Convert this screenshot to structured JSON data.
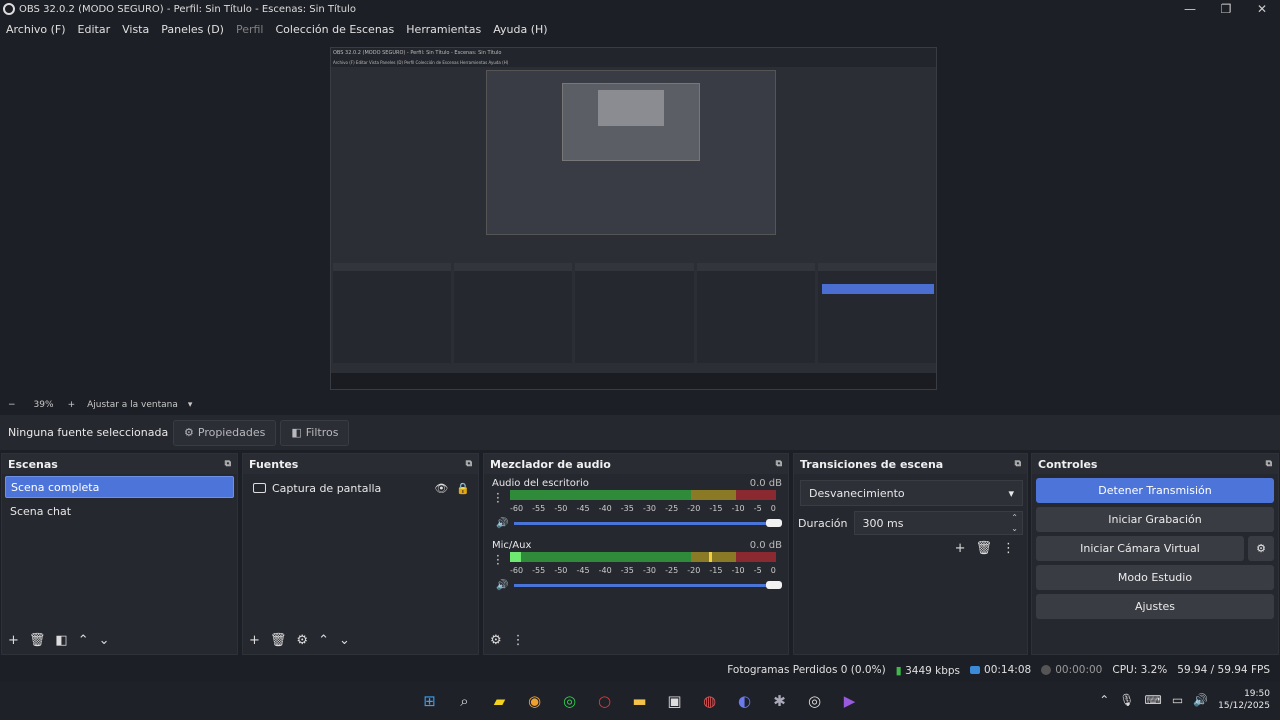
{
  "window": {
    "title": "OBS 32.0.2 (MODO SEGURO) - Perfil: Sin Título - Escenas: Sin Título",
    "minimize": "—",
    "maximize": "❐",
    "close": "✕"
  },
  "menu": [
    "Archivo (F)",
    "Editar",
    "Vista",
    "Paneles (D)",
    "Perfil",
    "Colección de Escenas",
    "Herramientas",
    "Ayuda (H)"
  ],
  "preview": {
    "inner_title": "OBS 32.0.2 (MODO SEGURO) - Perfil: Sin Título - Escenas: Sin Título",
    "inner_menu": "Archivo (F)  Editar  Vista  Paneles (D)  Perfil  Colección de Escenas  Herramientas  Ayuda (H)"
  },
  "zoom": {
    "minus": "−",
    "value": "39%",
    "plus": "+",
    "fit_label": "Ajustar a la ventana",
    "dropdown": "▾"
  },
  "properties_bar": {
    "no_source": "Ninguna fuente seleccionada",
    "properties_label": "Propiedades",
    "filters_label": "Filtros"
  },
  "scenes": {
    "title": "Escenas",
    "items": [
      "Scena completa",
      "Scena chat"
    ],
    "selected_index": 0
  },
  "sources": {
    "title": "Fuentes",
    "items": [
      "Captura de pantalla"
    ]
  },
  "mixer": {
    "title": "Mezclador de audio",
    "channels": [
      {
        "name": "Audio del escritorio",
        "db": "0.0 dB",
        "level": 0.0
      },
      {
        "name": "Mic/Aux",
        "db": "0.0 dB",
        "level": 0.07
      }
    ],
    "ticks": [
      "-60",
      "-55",
      "-50",
      "-45",
      "-40",
      "-35",
      "-30",
      "-25",
      "-20",
      "-15",
      "-10",
      "-5",
      "0"
    ]
  },
  "transitions": {
    "title": "Transiciones de escena",
    "selected": "Desvanecimiento",
    "duration_label": "Duración",
    "duration_value": "300 ms"
  },
  "controls": {
    "title": "Controles",
    "buttons": [
      "Detener Transmisión",
      "Iniciar Grabación",
      "Iniciar Cámara Virtual",
      "Modo Estudio",
      "Ajustes"
    ]
  },
  "status": {
    "dropped": "Fotogramas Perdidos 0 (0.0%)",
    "bitrate": "3449 kbps",
    "stream_time": "00:14:08",
    "rec_time": "00:00:00",
    "cpu": "CPU: 3.2%",
    "fps": "59.94 / 59.94 FPS"
  },
  "clock": {
    "time": "19:50",
    "date": "15/12/2025"
  },
  "colors": {
    "accent": "#4d74d8",
    "background": "#1d1f26",
    "panel": "#26282f"
  }
}
